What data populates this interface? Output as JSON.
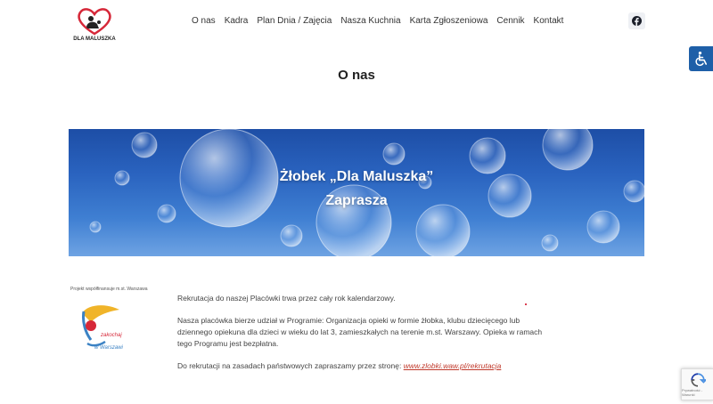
{
  "header": {
    "logo_text": "DLA MALUSZKA",
    "nav": [
      "O nas",
      "Kadra",
      "Plan Dnia / Zajęcia",
      "Nasza Kuchnia",
      "Karta Zgłoszeniowa",
      "Cennik",
      "Kontakt"
    ]
  },
  "page": {
    "title": "O nas"
  },
  "hero": {
    "line1": "Żłobek „Dla Maluszka”",
    "line2": "Zaprasza"
  },
  "sidebar": {
    "caption": "Projekt współfinansuje m.st. Warszawa",
    "logo_text": "zakochaj się w Warszawie"
  },
  "content": {
    "p1": "Rekrutacja do naszej Placówki trwa przez cały rok kalendarzowy.",
    "p2": "Nasza placówka bierze udział w Programie: Organizacja opieki w formie żłobka, klubu dziecięcego lub dziennego opiekuna dla dzieci w wieku do lat 3, zamieszkałych na terenie m.st. Warszawy. Opieka w ramach tego Programu jest bezpłatna.",
    "p3_text": "Do rekrutacji  na zasadach państwowych zapraszamy przez stronę: ",
    "p3_link": "www.zlobki.waw.pl/rekrutacja"
  },
  "recaptcha": {
    "label": "Prywatność - Warunki"
  },
  "colors": {
    "accent_blue": "#1e5fa8",
    "link_red": "#c0392b",
    "hero_blue": "#2a63bf"
  }
}
